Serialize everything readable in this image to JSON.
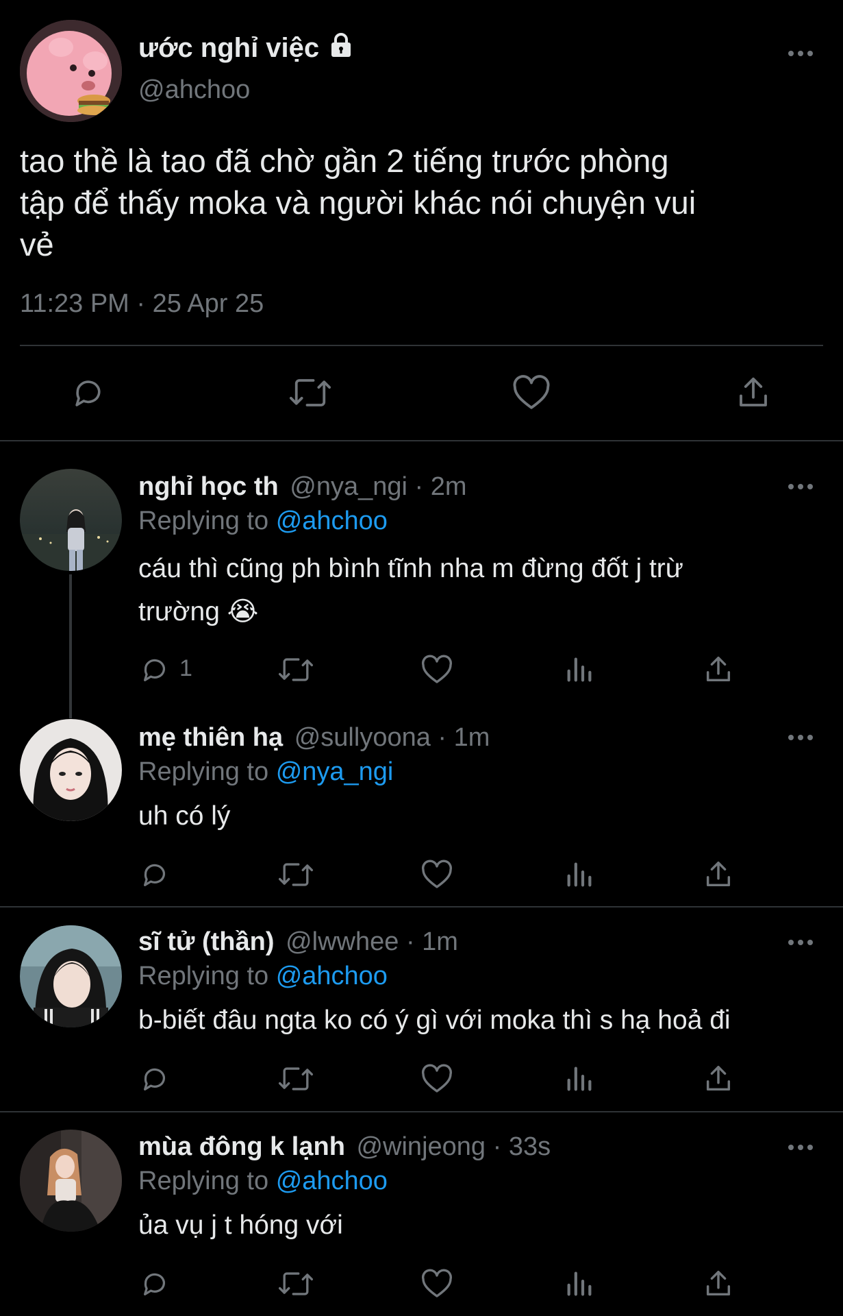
{
  "main_tweet": {
    "display_name": "ước nghỉ việc",
    "handle": "@ahchoo",
    "text_lines": [
      "tao thề là tao đã chờ gần 2 tiếng trước phòng",
      "tập để thấy moka và người khác nói chuyện vui",
      "vẻ"
    ],
    "timestamp": "11:23 PM · 25 Apr 25"
  },
  "replies": [
    {
      "display_name": "nghỉ học th",
      "handle": "@nya_ngi",
      "time": "· 2m",
      "replying_label": "Replying to",
      "replying_to": "@ahchoo",
      "text_lines": [
        "cáu thì cũng ph bình tĩnh nha m đừng đốt j trừ",
        "trường 😭"
      ],
      "reply_count": "1"
    },
    {
      "display_name": "mẹ thiên hạ",
      "handle": "@sullyoona",
      "time": "· 1m",
      "replying_label": "Replying to",
      "replying_to": "@nya_ngi",
      "text_lines": [
        "uh có lý"
      ]
    },
    {
      "display_name": "sĩ tử (thần)",
      "handle": "@lwwhee",
      "time": "· 1m",
      "replying_label": "Replying to",
      "replying_to": "@ahchoo",
      "text_lines": [
        "b-biết đâu ngta ko có ý gì với moka thì s hạ hoả đi"
      ]
    },
    {
      "display_name": "mùa đông k lạnh",
      "handle": "@winjeong",
      "time": "· 33s",
      "replying_label": "Replying to",
      "replying_to": "@ahchoo",
      "text_lines": [
        "ủa vụ j t hóng với"
      ]
    }
  ],
  "colors": {
    "background": "#000000",
    "text": "#e7e9ea",
    "muted": "#71767b",
    "link": "#1d9bf0",
    "divider": "#2f3336"
  },
  "icons": [
    "more-icon",
    "lock-icon",
    "reply-icon",
    "retweet-icon",
    "like-icon",
    "share-icon",
    "views-icon"
  ]
}
